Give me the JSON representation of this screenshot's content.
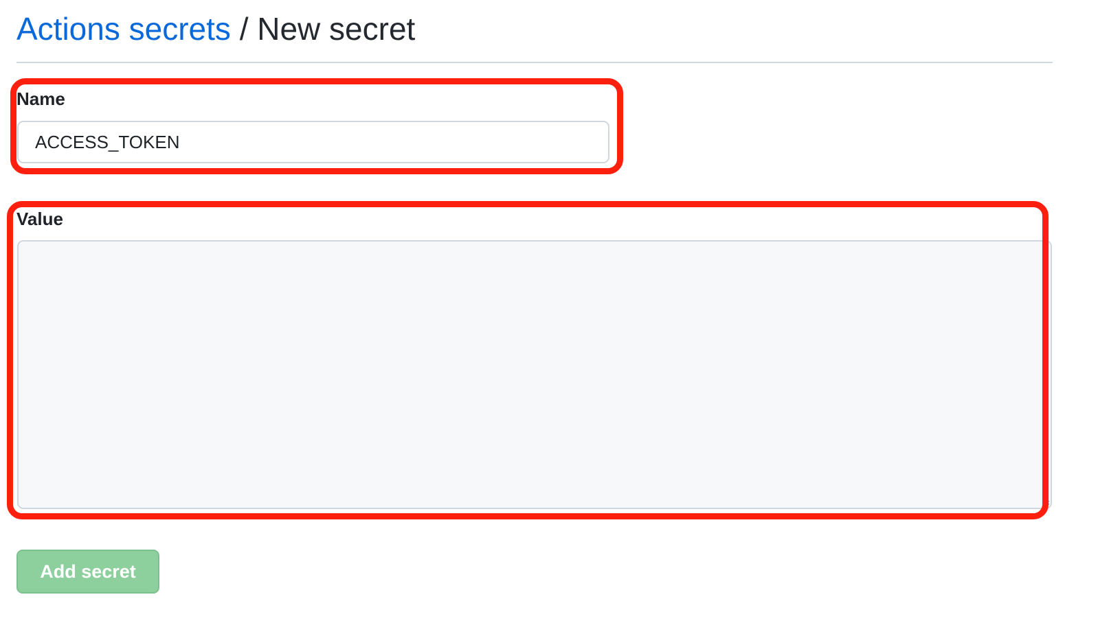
{
  "breadcrumb": {
    "parent_label": "Actions secrets",
    "separator": "/",
    "current_label": "New secret"
  },
  "form": {
    "name": {
      "label": "Name",
      "value": "ACCESS_TOKEN"
    },
    "value": {
      "label": "Value",
      "value": ""
    },
    "submit_label": "Add secret",
    "submit_disabled": true
  },
  "colors": {
    "link": "#0969da",
    "highlight": "#ff1f0f",
    "button_disabled_bg": "#8dd09e",
    "textarea_bg": "#f6f8fa",
    "border": "#d0d7de"
  }
}
